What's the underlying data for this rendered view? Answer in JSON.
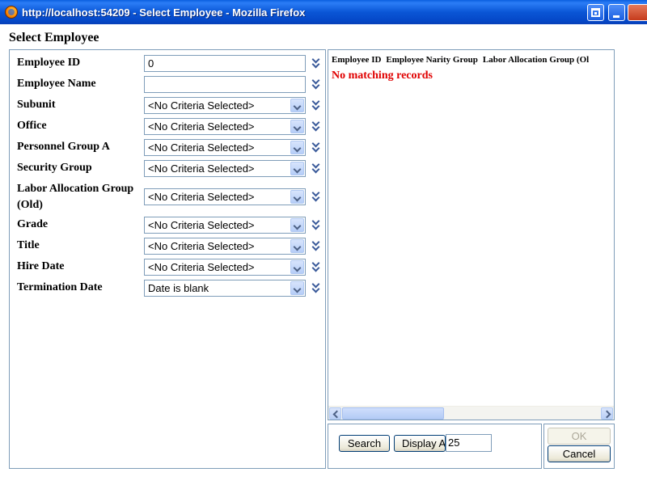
{
  "window": {
    "title": "http://localhost:54209 - Select Employee - Mozilla Firefox",
    "icons": [
      "firefox-icon",
      "restore-icon",
      "minimize-icon",
      "close-icon"
    ]
  },
  "dialog": {
    "title": "Select Employee"
  },
  "criteria": [
    {
      "label": "Employee ID",
      "type": "text",
      "value": "0"
    },
    {
      "label": "Employee Name",
      "type": "text",
      "value": ""
    },
    {
      "label": "Subunit",
      "type": "select",
      "value": "<No Criteria Selected>"
    },
    {
      "label": "Office",
      "type": "select",
      "value": "<No Criteria Selected>"
    },
    {
      "label": "Personnel Group A",
      "type": "select",
      "value": "<No Criteria Selected>"
    },
    {
      "label": "Security Group",
      "type": "select",
      "value": "<No Criteria Selected>"
    },
    {
      "label": "Labor Allocation Group (Old)",
      "type": "select",
      "value": "<No Criteria Selected>"
    },
    {
      "label": "Grade",
      "type": "select",
      "value": "<No Criteria Selected>"
    },
    {
      "label": "Title",
      "type": "select",
      "value": "<No Criteria Selected>"
    },
    {
      "label": "Hire Date",
      "type": "select",
      "value": "<No Criteria Selected>"
    },
    {
      "label": "Termination Date",
      "type": "select",
      "value": "Date is blank"
    }
  ],
  "results": {
    "columns": [
      "Employee ID",
      "Employee Narity Group",
      "Labor Allocation Group (Ol"
    ],
    "empty_message": "No matching records"
  },
  "actions": {
    "search_label": "Search",
    "display_label": "Display All",
    "page_size": "25",
    "ok_label": "OK",
    "cancel_label": "Cancel"
  },
  "colors": {
    "titlebar": "#0a56d6",
    "border": "#7f9db9",
    "empty_message": "#e00000"
  }
}
